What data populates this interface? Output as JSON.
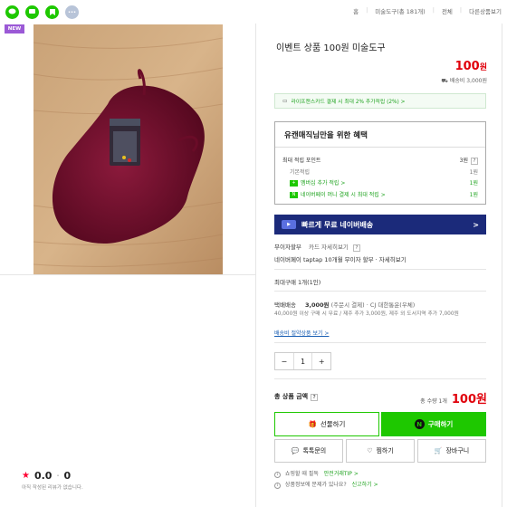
{
  "topbar": {
    "share_icons": [
      "talk-icon",
      "chat-icon",
      "bookmark-icon",
      "more-icon"
    ],
    "more_label": "···",
    "crumbs": [
      "홈",
      "미술도구(총 181개)",
      "전체",
      "다른상품보기"
    ]
  },
  "badge": "NEW",
  "rating": {
    "score": "0.0",
    "count": "0",
    "note": "아직 작성된 리뷰가 없습니다."
  },
  "product": {
    "title": "이벤트 상품 100원 미술도구",
    "price": "100",
    "price_unit": "원",
    "shipping_note": "배송비 3,000원"
  },
  "card_banner": "라이프캔스카드 결제 시 최대 2% 추가적립 (2%) >",
  "benefit": {
    "title": "유캔매직님만을 위한 혜택",
    "max_points_label": "최대 적립 포인트",
    "max_points_value": "3원",
    "rows": [
      {
        "label": "기본적립",
        "value": "1원"
      },
      {
        "label": "멤버십 추가 적립 >",
        "value": "1원"
      },
      {
        "label": "네이버페이 머니 결제 시 최대 적립 >",
        "value": "1원"
      }
    ]
  },
  "naver_ship": {
    "label": "빠르게 무료 네이버배송",
    "arrow": ">"
  },
  "payment": {
    "interest_free": "무이자할부",
    "card_detail": "카드 자세히보기",
    "taptap": "네이버페이 taptap 10개월 무이자 할부 · 자세히보기"
  },
  "max_purchase": "최대구매 1개(1인)",
  "delivery": {
    "label": "택배배송",
    "fee": "3,000원",
    "fee_note": "(주문시 결제) · CJ 대한통운(우체)",
    "note": "40,000원 이상 구매 시 무료 / 제주 추가 3,000원, 제주 외 도서지역 추가 7,000원",
    "link": "배송비 절약상품 보기 >"
  },
  "quantity": {
    "minus": "−",
    "value": "1",
    "plus": "+"
  },
  "total": {
    "label": "총 상품 금액",
    "qty": "총 수량 1개",
    "amount": "100원"
  },
  "buttons": {
    "gift": "선물하기",
    "buy": "구매하기",
    "inquiry": "톡톡문의",
    "wish": "찜하기",
    "cart": "장바구니"
  },
  "footer": {
    "safe_label": "쇼핑할 때 필독",
    "safe_link": "안전거래TIP >",
    "report_label": "상품정보에 문제가 있나요?",
    "report_link": "신고하기 >"
  },
  "colors": {
    "accent": "#1ec800",
    "price": "#e0000b",
    "ship_bg": "#1b2a7a"
  }
}
